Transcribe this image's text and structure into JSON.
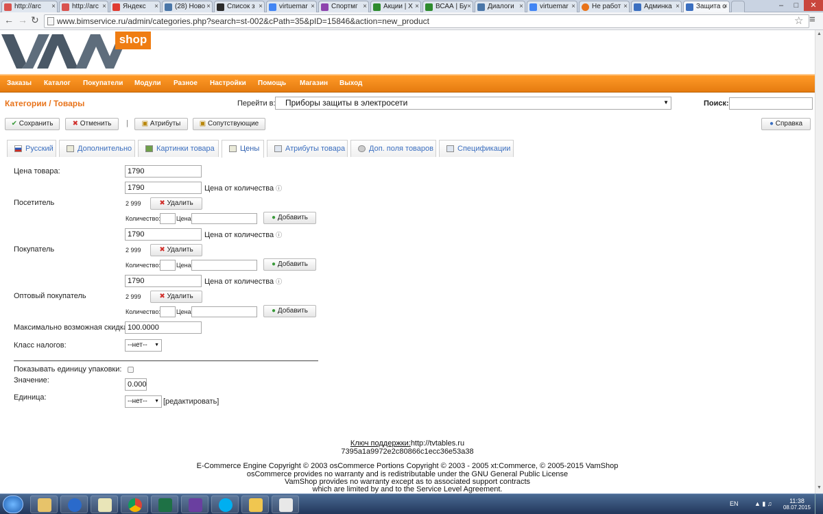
{
  "browser": {
    "tabs": [
      {
        "label": "http://arc",
        "color": "#d9534f"
      },
      {
        "label": "http://arc",
        "color": "#d9534f"
      },
      {
        "label": "Яндекс",
        "color": "#e03c31"
      },
      {
        "label": "(28) Ново",
        "color": "#4a76a8"
      },
      {
        "label": "Список з",
        "color": "#2b2b2b"
      },
      {
        "label": "virtuemar",
        "color": "#4285f4"
      },
      {
        "label": "Спортмг",
        "color": "#8e44ad"
      },
      {
        "label": "Акции | Х",
        "color": "#2e8b2e"
      },
      {
        "label": "ВСАА | Бу",
        "color": "#2e8b2e"
      },
      {
        "label": "Диалоги",
        "color": "#4a76a8"
      },
      {
        "label": "virtuemar",
        "color": "#4285f4"
      },
      {
        "label": "Не работ",
        "color": "#e8731a"
      },
      {
        "label": "Админка",
        "color": "#3b6fc0"
      },
      {
        "label": "Защита о",
        "color": "#3b6fc0"
      }
    ],
    "close_glyph": "×",
    "url": "www.bimservice.ru/admin/categories.php?search=st-002&cPath=35&pID=15846&action=new_product"
  },
  "logo": {
    "brand": "VAM",
    "shop": "shop"
  },
  "menu": [
    "Заказы",
    "Каталог",
    "Покупатели",
    "Модули",
    "Разное",
    "Настройки",
    "Помощь",
    "Магазин",
    "Выход"
  ],
  "header": {
    "title": "Категории / Товары",
    "goto_label": "Перейти в:",
    "goto_value": "Приборы защиты в электросети",
    "search_label": "Поиск:"
  },
  "toolbar": {
    "save": "Сохранить",
    "cancel": "Отменить",
    "separator": "|",
    "attributes": "Атрибуты",
    "related": "Сопутствующие",
    "help": "Справка"
  },
  "tabs": [
    "Русский",
    "Дополнительно",
    "Картинки товара",
    "Цены",
    "Атрибуты товара",
    "Доп. поля товаров",
    "Спецификации"
  ],
  "prices": {
    "price_label": "Цена товара:",
    "price_value": "1790",
    "qty_price_label": "Цена от количества",
    "delete_label": "Удалить",
    "add_label": "Добавить",
    "qty_label": "Количество:",
    "price_small_label": "Цена:",
    "groups": [
      {
        "name": "Посетитель",
        "value": "1790",
        "tier": "2  999"
      },
      {
        "name": "Покупатель",
        "value": "1790",
        "tier": "2  999"
      },
      {
        "name": "Оптовый покупатель",
        "value": "1790",
        "tier": "2  999"
      }
    ],
    "max_discount_label": "Максимально возможная скидка:",
    "max_discount_value": "100.0000",
    "tax_label": "Класс налогов:",
    "tax_value": "--нет--",
    "show_unit_label": "Показывать единицу упаковки:",
    "value_label": "Значение:",
    "value_value": "0.000",
    "unit_label": "Единица:",
    "unit_value": "--нет--",
    "edit_link": "[редактировать]"
  },
  "footer": {
    "support_key_label": "Ключ поддержки:",
    "support_url": "http://tvtables.ru",
    "support_hash": "7395a1a9972e2c80866c1ecc36e53a38",
    "line1": "E-Commerce Engine Copyright © 2003 osCommerce Portions Copyright © 2003 - 2005 xt:Commerce, © 2005-2015 VamShop",
    "line2": "osCommerce provides no warranty and is redistributable under the GNU General Public License",
    "line3": "VamShop provides no warranty except as to associated support contracts",
    "line4": "which are limited by and to the Service Level Agreement."
  },
  "taskbar": {
    "lang": "EN",
    "time": "11:38",
    "date": "08.07.2015"
  }
}
